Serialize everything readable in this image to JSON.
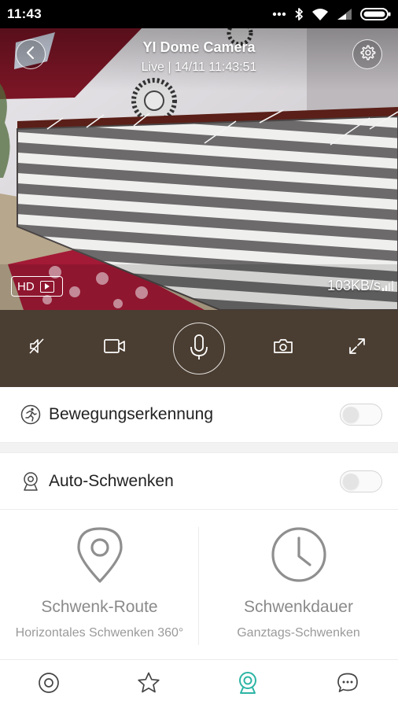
{
  "status_bar": {
    "time": "11:43",
    "icons": [
      "more-dots-icon",
      "bluetooth-icon",
      "wifi-icon",
      "cell-signal-icon",
      "battery-icon"
    ]
  },
  "video": {
    "title": "YI Dome Camera",
    "subtitle": "Live | 14/11 11:43:51",
    "quality_label": "HD",
    "bitrate": "103KB/s",
    "back_icon": "chevron-left-icon",
    "settings_icon": "gear-icon"
  },
  "controls": [
    {
      "name": "mute-toggle",
      "icon": "speaker-muted-icon"
    },
    {
      "name": "record",
      "icon": "video-camera-icon"
    },
    {
      "name": "talk",
      "icon": "microphone-icon"
    },
    {
      "name": "snapshot",
      "icon": "camera-icon"
    },
    {
      "name": "fullscreen",
      "icon": "expand-icon"
    }
  ],
  "settings": {
    "motion_detection": {
      "label": "Bewegungserkennung",
      "enabled": false,
      "icon": "running-person-icon"
    },
    "auto_pan": {
      "label": "Auto-Schwenken",
      "enabled": false,
      "icon": "webcam-icon"
    }
  },
  "tiles": [
    {
      "title": "Schwenk-Route",
      "subtitle": "Horizontales Schwenken 360°",
      "icon": "location-pin-icon"
    },
    {
      "title": "Schwenkdauer",
      "subtitle": "Ganztags-Schwenken",
      "icon": "clock-icon"
    }
  ],
  "bottom_nav": [
    {
      "icon": "record-circle-icon",
      "active": false
    },
    {
      "icon": "star-icon",
      "active": false
    },
    {
      "icon": "camera-device-icon",
      "active": true
    },
    {
      "icon": "chat-bubble-icon",
      "active": false
    }
  ],
  "colors": {
    "accent": "#2cb5a5",
    "control_bar": "#4a3d31",
    "icon_gray": "#8f8f8f"
  }
}
